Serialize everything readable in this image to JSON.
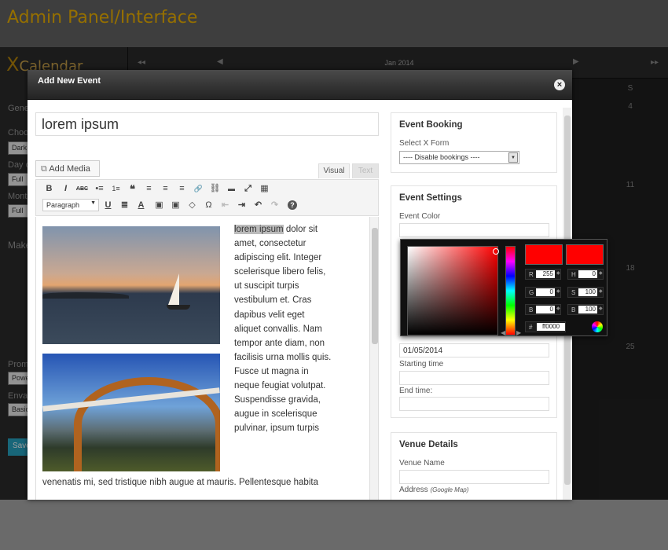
{
  "banner": {
    "title": "Admin Panel/Interface"
  },
  "background_app": {
    "logo_text": "Calendar",
    "nav_prev": "◂◂",
    "nav_next": "▸▸",
    "month": "Jan 2014",
    "day_header": "S",
    "day_numbers": [
      "4",
      "11",
      "18",
      "25"
    ],
    "side_labels": [
      "Gene",
      "Choo",
      "Day o",
      "Mont",
      "Make",
      "Prom",
      "Envat"
    ],
    "side_selects": [
      "Dark",
      "Full",
      "Full",
      "Powe",
      "Basic"
    ],
    "side_save": "Save"
  },
  "modal": {
    "title": "Add New Event",
    "close_icon": "close-icon",
    "event_title": "lorem ipsum",
    "add_media_label": "Add Media",
    "tab_visual": "Visual",
    "tab_text": "Text",
    "toolbar": {
      "row1": [
        "B",
        "I",
        "ABC",
        "•≡",
        "1≡",
        "❝",
        "≡",
        "≡",
        "≡",
        "🔗",
        "⛓",
        "▬",
        "⤢",
        "▦"
      ],
      "format_select": "Paragraph",
      "row2": [
        "U",
        "≣",
        "A",
        "▣",
        "▣",
        "◇",
        "Ω",
        "⇤",
        "⇥",
        "↶",
        "↷",
        "?"
      ]
    },
    "editor": {
      "highlighted": "lorem ipsum",
      "text_after_highlight": " dolor sit amet, consectetur adipiscing elit. Integer scelerisque libero felis, ut suscipit turpis vestibulum et. Cras dapibus velit eget aliquet convallis. Nam tempor ante diam, non facilisis urna mollis quis. Fusce ut magna in neque feugiat volutpat. Suspendisse gravida, augue in scelerisque pulvinar, ipsum turpis",
      "last_line": "venenatis mi, sed tristique nibh augue at mauris. Pellentesque habita"
    },
    "event_booking": {
      "title": "Event Booking",
      "select_label": "Select X Form",
      "select_value": "---- Disable bookings ----"
    },
    "event_settings": {
      "title": "Event Settings",
      "color_label": "Event Color",
      "color_value": "",
      "end_date_value": "01/05/2014",
      "starting_time_label": "Starting time",
      "end_time_label": "End time:"
    },
    "venue_details": {
      "title": "Venue Details",
      "name_label": "Venue Name",
      "address_label": "Address",
      "address_hint": "(Google Map)"
    }
  },
  "color_picker": {
    "selected_color": "#ff0000",
    "r": "255",
    "g": "0",
    "b": "0",
    "h": "0",
    "s": "100",
    "br": "100",
    "hex": "ff0000",
    "labels": {
      "r": "R",
      "g": "G",
      "b": "B",
      "h": "H",
      "s": "S",
      "br": "B",
      "hex": "#"
    }
  }
}
